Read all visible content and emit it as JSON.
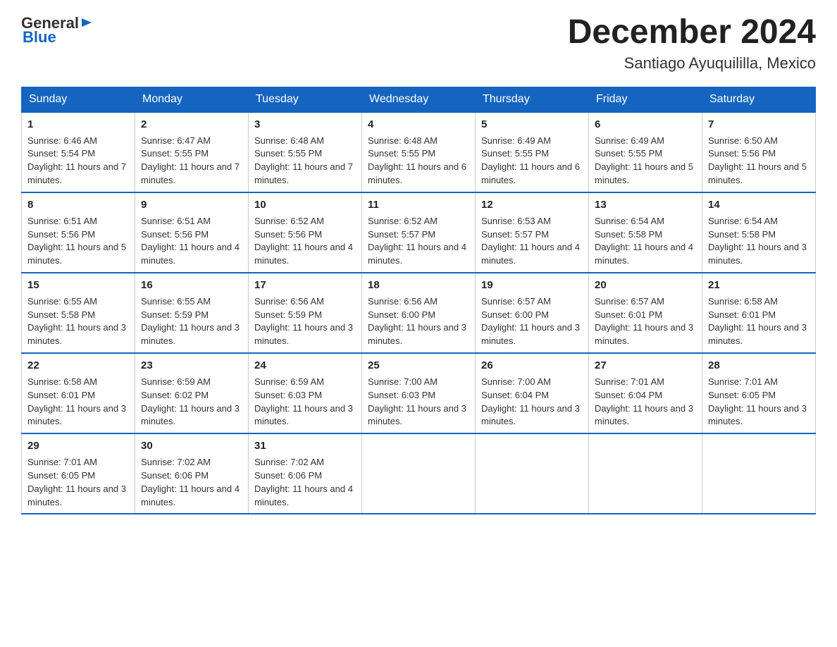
{
  "logo": {
    "general": "General",
    "blue": "Blue"
  },
  "title": "December 2024",
  "subtitle": "Santiago Ayuquililla, Mexico",
  "days": [
    "Sunday",
    "Monday",
    "Tuesday",
    "Wednesday",
    "Thursday",
    "Friday",
    "Saturday"
  ],
  "weeks": [
    [
      {
        "day": "1",
        "sunrise": "6:46 AM",
        "sunset": "5:54 PM",
        "daylight": "11 hours and 7 minutes."
      },
      {
        "day": "2",
        "sunrise": "6:47 AM",
        "sunset": "5:55 PM",
        "daylight": "11 hours and 7 minutes."
      },
      {
        "day": "3",
        "sunrise": "6:48 AM",
        "sunset": "5:55 PM",
        "daylight": "11 hours and 7 minutes."
      },
      {
        "day": "4",
        "sunrise": "6:48 AM",
        "sunset": "5:55 PM",
        "daylight": "11 hours and 6 minutes."
      },
      {
        "day": "5",
        "sunrise": "6:49 AM",
        "sunset": "5:55 PM",
        "daylight": "11 hours and 6 minutes."
      },
      {
        "day": "6",
        "sunrise": "6:49 AM",
        "sunset": "5:55 PM",
        "daylight": "11 hours and 5 minutes."
      },
      {
        "day": "7",
        "sunrise": "6:50 AM",
        "sunset": "5:56 PM",
        "daylight": "11 hours and 5 minutes."
      }
    ],
    [
      {
        "day": "8",
        "sunrise": "6:51 AM",
        "sunset": "5:56 PM",
        "daylight": "11 hours and 5 minutes."
      },
      {
        "day": "9",
        "sunrise": "6:51 AM",
        "sunset": "5:56 PM",
        "daylight": "11 hours and 4 minutes."
      },
      {
        "day": "10",
        "sunrise": "6:52 AM",
        "sunset": "5:56 PM",
        "daylight": "11 hours and 4 minutes."
      },
      {
        "day": "11",
        "sunrise": "6:52 AM",
        "sunset": "5:57 PM",
        "daylight": "11 hours and 4 minutes."
      },
      {
        "day": "12",
        "sunrise": "6:53 AM",
        "sunset": "5:57 PM",
        "daylight": "11 hours and 4 minutes."
      },
      {
        "day": "13",
        "sunrise": "6:54 AM",
        "sunset": "5:58 PM",
        "daylight": "11 hours and 4 minutes."
      },
      {
        "day": "14",
        "sunrise": "6:54 AM",
        "sunset": "5:58 PM",
        "daylight": "11 hours and 3 minutes."
      }
    ],
    [
      {
        "day": "15",
        "sunrise": "6:55 AM",
        "sunset": "5:58 PM",
        "daylight": "11 hours and 3 minutes."
      },
      {
        "day": "16",
        "sunrise": "6:55 AM",
        "sunset": "5:59 PM",
        "daylight": "11 hours and 3 minutes."
      },
      {
        "day": "17",
        "sunrise": "6:56 AM",
        "sunset": "5:59 PM",
        "daylight": "11 hours and 3 minutes."
      },
      {
        "day": "18",
        "sunrise": "6:56 AM",
        "sunset": "6:00 PM",
        "daylight": "11 hours and 3 minutes."
      },
      {
        "day": "19",
        "sunrise": "6:57 AM",
        "sunset": "6:00 PM",
        "daylight": "11 hours and 3 minutes."
      },
      {
        "day": "20",
        "sunrise": "6:57 AM",
        "sunset": "6:01 PM",
        "daylight": "11 hours and 3 minutes."
      },
      {
        "day": "21",
        "sunrise": "6:58 AM",
        "sunset": "6:01 PM",
        "daylight": "11 hours and 3 minutes."
      }
    ],
    [
      {
        "day": "22",
        "sunrise": "6:58 AM",
        "sunset": "6:01 PM",
        "daylight": "11 hours and 3 minutes."
      },
      {
        "day": "23",
        "sunrise": "6:59 AM",
        "sunset": "6:02 PM",
        "daylight": "11 hours and 3 minutes."
      },
      {
        "day": "24",
        "sunrise": "6:59 AM",
        "sunset": "6:03 PM",
        "daylight": "11 hours and 3 minutes."
      },
      {
        "day": "25",
        "sunrise": "7:00 AM",
        "sunset": "6:03 PM",
        "daylight": "11 hours and 3 minutes."
      },
      {
        "day": "26",
        "sunrise": "7:00 AM",
        "sunset": "6:04 PM",
        "daylight": "11 hours and 3 minutes."
      },
      {
        "day": "27",
        "sunrise": "7:01 AM",
        "sunset": "6:04 PM",
        "daylight": "11 hours and 3 minutes."
      },
      {
        "day": "28",
        "sunrise": "7:01 AM",
        "sunset": "6:05 PM",
        "daylight": "11 hours and 3 minutes."
      }
    ],
    [
      {
        "day": "29",
        "sunrise": "7:01 AM",
        "sunset": "6:05 PM",
        "daylight": "11 hours and 3 minutes."
      },
      {
        "day": "30",
        "sunrise": "7:02 AM",
        "sunset": "6:06 PM",
        "daylight": "11 hours and 4 minutes."
      },
      {
        "day": "31",
        "sunrise": "7:02 AM",
        "sunset": "6:06 PM",
        "daylight": "11 hours and 4 minutes."
      },
      null,
      null,
      null,
      null
    ]
  ]
}
